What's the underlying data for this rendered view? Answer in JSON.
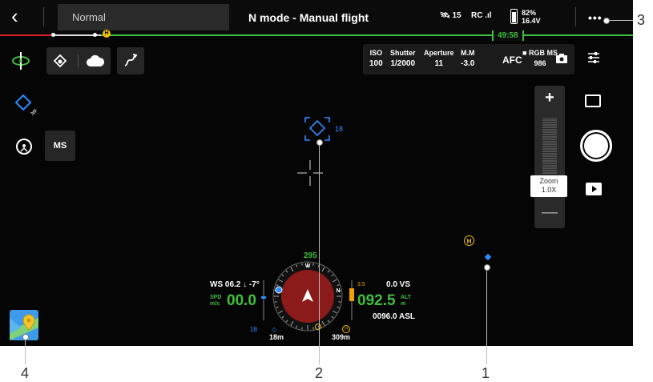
{
  "topbar": {
    "mode_label": "Normal",
    "title": "N mode - Manual flight",
    "satellites": "15",
    "rc_label": "RC",
    "battery_percent": "82%",
    "battery_voltage": "16.4V",
    "more_label": "•••"
  },
  "progress": {
    "timer": "49:58",
    "home_label": "H"
  },
  "left_toolbar": {
    "ms_label": "MS"
  },
  "camera": {
    "iso_label": "ISO",
    "iso_value": "100",
    "shutter_label": "Shutter",
    "shutter_value": "1/2000",
    "aperture_label": "Aperture",
    "aperture_value": "11",
    "mm_label": "M.M",
    "mm_value": "-3.0",
    "focus_mode": "AFC",
    "lens_label": "RGB MS",
    "remaining": "986"
  },
  "zoom": {
    "plus": "+",
    "minus": "—",
    "label": "Zoom",
    "value": "1.0X"
  },
  "tracking": {
    "target_distance": "18"
  },
  "map_markers": {
    "home_label": "H"
  },
  "instruments": {
    "wind": "WS 06.2 ↓  -7°",
    "speed_unit_top": "SPD",
    "speed_unit_bottom": "m/s",
    "speed": "00.0",
    "vertical_speed": "0.0  VS",
    "altitude": "092.5",
    "alt_unit_top": "ALT",
    "alt_unit_bottom": "m",
    "asl": "0096.0 ASL",
    "heading": "295",
    "obstacle_value": "3.5",
    "side_number": "18",
    "distance_target": "18m",
    "distance_home": "309m",
    "compass_n": "N",
    "compass_w": "W",
    "home_label": "H"
  },
  "callouts": [
    "1",
    "2",
    "3",
    "4"
  ],
  "colors": {
    "accent_green": "#3fbf3f",
    "accent_blue": "#2c8cff",
    "home_yellow": "#f0c000",
    "compass_red": "#8b1a1a"
  }
}
